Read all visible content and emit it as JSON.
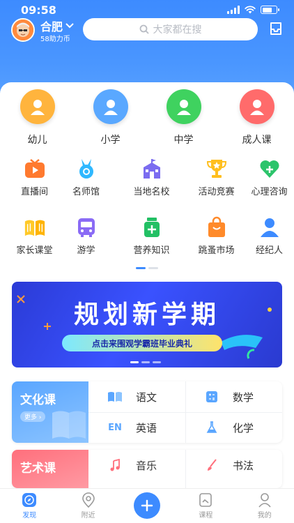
{
  "status": {
    "time": "09:58"
  },
  "header": {
    "city": "合肥",
    "coins": "58助力币",
    "search_placeholder": "大家都在搜"
  },
  "categories": [
    {
      "label": "幼儿",
      "color": "#ffb43d",
      "icon": "child-icon"
    },
    {
      "label": "小学",
      "color": "#5aa8ff",
      "icon": "pupil-icon"
    },
    {
      "label": "中学",
      "color": "#3fd25f",
      "icon": "student-icon"
    },
    {
      "label": "成人课",
      "color": "#ff6b6b",
      "icon": "adult-icon"
    }
  ],
  "grid_row1": [
    {
      "label": "直播间",
      "icon": "tv-icon"
    },
    {
      "label": "名师馆",
      "icon": "medal-icon"
    },
    {
      "label": "当地名校",
      "icon": "school-icon"
    },
    {
      "label": "活动竞赛",
      "icon": "trophy-icon"
    },
    {
      "label": "心理咨询",
      "icon": "heart-icon"
    }
  ],
  "grid_row2": [
    {
      "label": "家长课堂",
      "icon": "book-icon"
    },
    {
      "label": "游学",
      "icon": "bus-icon"
    },
    {
      "label": "营养知识",
      "icon": "jar-icon"
    },
    {
      "label": "跳蚤市场",
      "icon": "bag-icon"
    },
    {
      "label": "经纪人",
      "icon": "person-icon"
    }
  ],
  "banner": {
    "title": "规划新学期",
    "subtitle": "点击来围观学霸班毕业典礼"
  },
  "culture": {
    "title": "文化课",
    "more": "更多",
    "subjects": [
      "语文",
      "数学",
      "英语",
      "化学"
    ],
    "en_glyph": "EN"
  },
  "arts": {
    "title": "艺术课",
    "subjects": [
      "音乐",
      "书法"
    ]
  },
  "nav": {
    "discover": "发现",
    "nearby": "附近",
    "course": "课程",
    "mine": "我的"
  },
  "colors": {
    "primary": "#3d8bff",
    "culture_panel": "#6fb3ff",
    "arts_panel": "#ff7a85"
  }
}
